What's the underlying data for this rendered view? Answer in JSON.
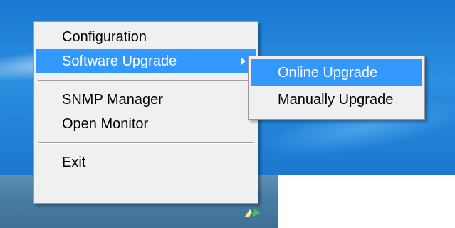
{
  "menu": {
    "items": [
      {
        "label": "Configuration"
      },
      {
        "label": "Software Upgrade"
      },
      {
        "label": "SNMP Manager"
      },
      {
        "label": "Open Monitor"
      },
      {
        "label": "Exit"
      }
    ]
  },
  "submenu": {
    "items": [
      {
        "label": "Online Upgrade"
      },
      {
        "label": "Manually Upgrade"
      }
    ]
  },
  "icons": {
    "submenu_arrow": "chevron-right-icon",
    "tray": "tray-app-icon"
  },
  "colors": {
    "highlight": "#3399ff",
    "menu_bg": "#f0f0f0",
    "desktop": "#2b8fe0"
  }
}
